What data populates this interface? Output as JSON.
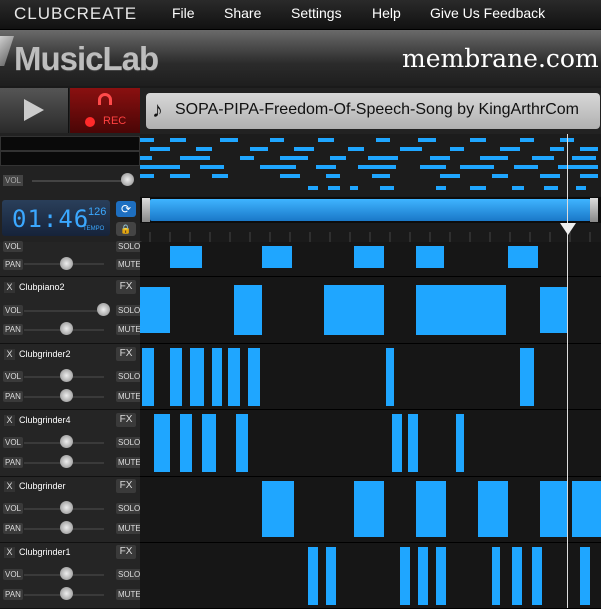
{
  "menubar": {
    "brand": "CLUBCREATE",
    "items": [
      "File",
      "Share",
      "Settings",
      "Help",
      "Give Us Feedback"
    ]
  },
  "header": {
    "logo": "MusicLab",
    "site": "membrane.com"
  },
  "transport": {
    "rec_label": "REC",
    "song_title": "SOPA-PIPA-Freedom-Of-Speech-Song by KingArthrCom",
    "note_icon": "♪"
  },
  "master": {
    "vol_label": "VOL",
    "time": "01:46",
    "tempo": "126",
    "tempo_label": "TEMPO"
  },
  "labels": {
    "pan": "PAN",
    "vol": "VOL",
    "solo": "SOLO",
    "mute": "MUTE",
    "fx": "FX",
    "close": "X"
  },
  "tracks": [
    {
      "name": ""
    },
    {
      "name": "Clubpiano2"
    },
    {
      "name": "Clubgrinder2"
    },
    {
      "name": "Clubgrinder4"
    },
    {
      "name": "Clubgrinder"
    },
    {
      "name": "Clubgrinder1"
    }
  ],
  "colors": {
    "accent": "#1fa6ff",
    "rec": "#ff2a2a"
  }
}
